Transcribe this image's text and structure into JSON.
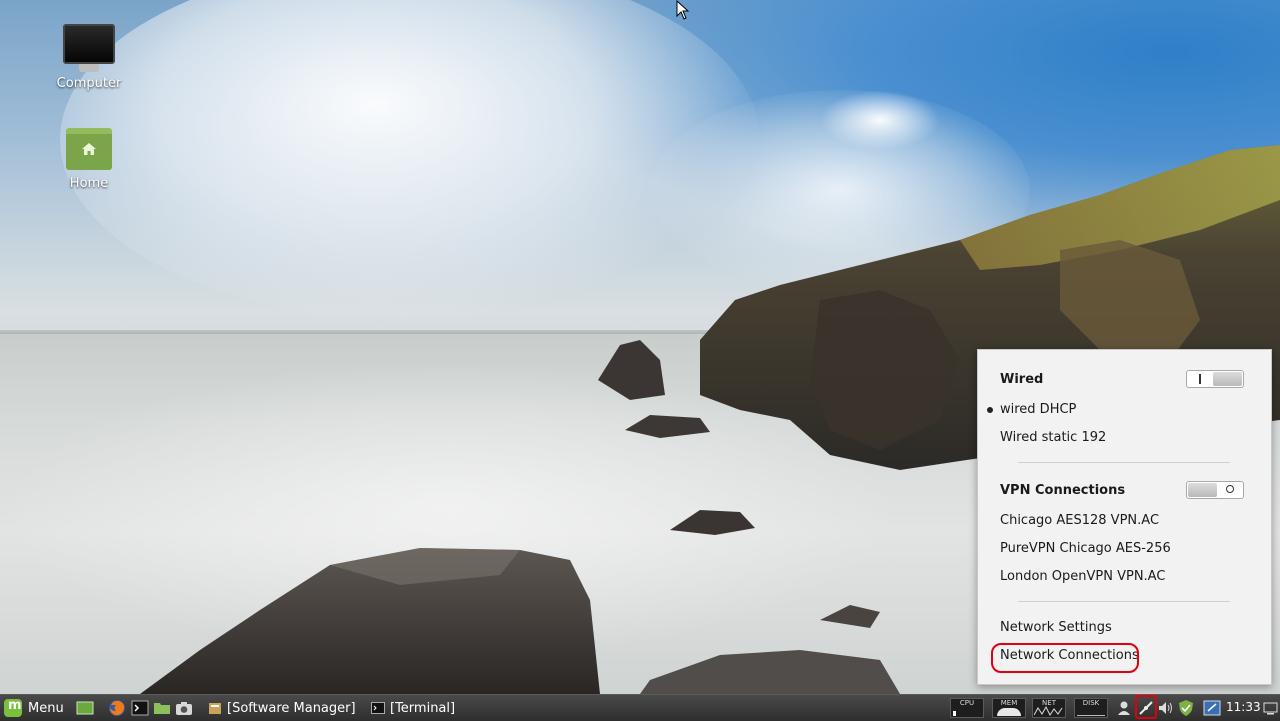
{
  "desktop": {
    "icons": [
      {
        "label": "Computer",
        "icon": "computer-icon"
      },
      {
        "label": "Home",
        "icon": "home-folder-icon"
      }
    ]
  },
  "network_menu": {
    "wired": {
      "title": "Wired",
      "switch_state": "on",
      "items": [
        {
          "label": "wired DHCP",
          "active": true
        },
        {
          "label": "Wired static 192",
          "active": false
        }
      ]
    },
    "vpn": {
      "title": "VPN Connections",
      "switch_state": "off",
      "items": [
        {
          "label": "Chicago AES128 VPN.AC"
        },
        {
          "label": "PureVPN Chicago AES-256"
        },
        {
          "label": "London OpenVPN VPN.AC"
        }
      ]
    },
    "footer": {
      "settings_label": "Network Settings",
      "connections_label": "Network Connections"
    },
    "highlight_color": "#e0000f"
  },
  "taskbar": {
    "menu_label": "Menu",
    "launchers": [
      "show-desktop-icon",
      "firefox-icon",
      "terminal-icon",
      "files-icon",
      "screenshot-icon"
    ],
    "windows": [
      {
        "label": "[Software Manager]",
        "icon": "software-manager-icon"
      },
      {
        "label": "[Terminal]",
        "icon": "terminal-icon"
      }
    ],
    "monitors": [
      {
        "label": "CPU"
      },
      {
        "label": "MEM"
      },
      {
        "label": "NET"
      },
      {
        "label": "DISK"
      }
    ],
    "tray": [
      "user-icon",
      "network-icon",
      "volume-icon",
      "update-shield-icon",
      "workspace-icon"
    ],
    "clock": "11:33"
  }
}
